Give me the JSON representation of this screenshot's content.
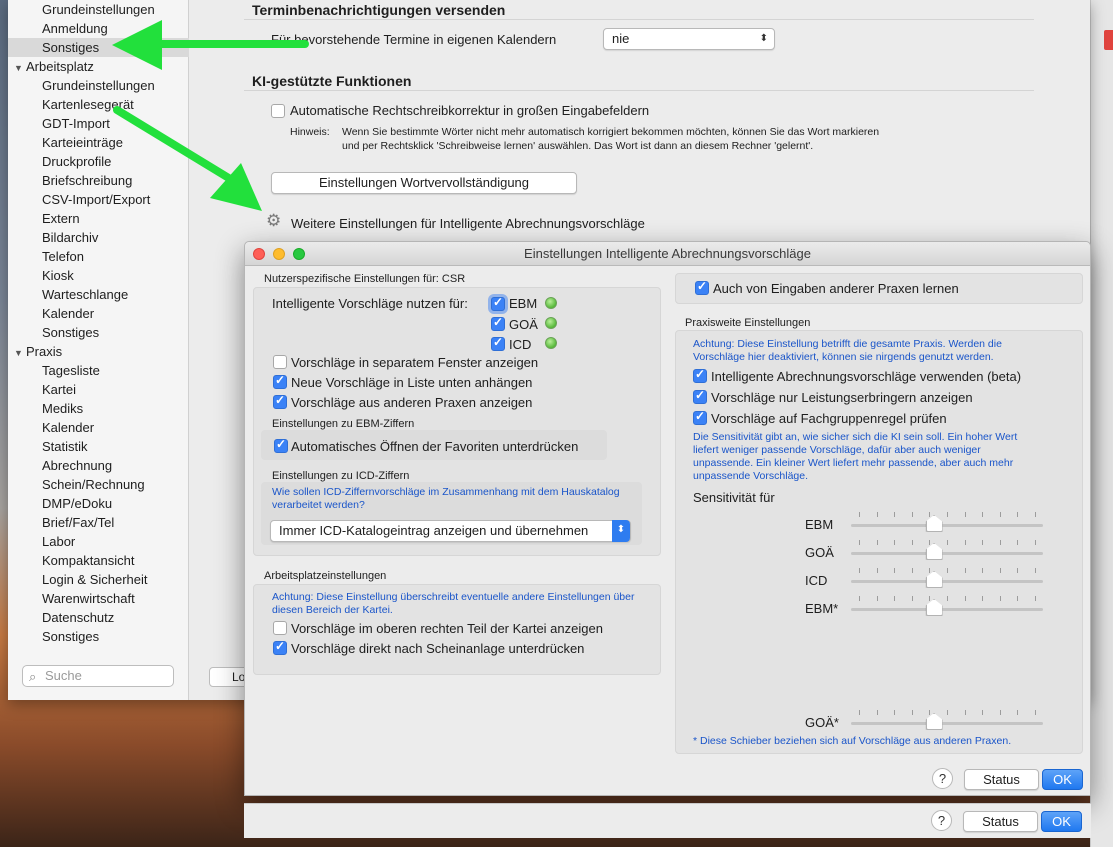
{
  "sidebar": {
    "items_top": [
      "Grundeinstellungen",
      "Anmeldung",
      "Sonstiges"
    ],
    "group_arbeitsplatz": "Arbeitsplatz",
    "arbeitsplatz_items": [
      "Grundeinstellungen",
      "Kartenlesegerät",
      "GDT-Import",
      "Karteieinträge",
      "Druckprofile",
      "Briefschreibung",
      "CSV-Import/Export",
      "Extern",
      "Bildarchiv",
      "Telefon",
      "Kiosk",
      "Warteschlange",
      "Kalender",
      "Sonstiges"
    ],
    "group_praxis": "Praxis",
    "praxis_items": [
      "Tagesliste",
      "Kartei",
      "Mediks",
      "Kalender",
      "Statistik",
      "Abrechnung",
      "Schein/Rechnung",
      "DMP/eDoku",
      "Brief/Fax/Tel",
      "Labor",
      "Kompaktansicht",
      "Login & Sicherheit",
      "Warenwirtschaft",
      "Datenschutz",
      "Sonstiges"
    ],
    "search_placeholder": "Suche",
    "lo_button": "Lo"
  },
  "content": {
    "termin_title": "Terminbenachrichtigungen versenden",
    "termin_label": "Für bevorstehende Termine in eigenen Kalendern",
    "termin_value": "nie",
    "ki_title": "KI-gestützte Funktionen",
    "autocorrect_label": "Automatische Rechtschreibkorrektur in großen Eingabefeldern",
    "hint_label": "Hinweis:",
    "hint_text_1": "Wenn Sie bestimmte Wörter nicht mehr automatisch korrigiert bekommen möchten, können Sie das Wort markieren",
    "hint_text_2": "und per Rechtsklick 'Schreibweise lernen' auswählen. Das Wort ist dann an diesem Rechner 'gelernt'.",
    "wordcompletion_button": "Einstellungen Wortvervollständigung",
    "weitere_label": "Weitere Einstellungen für Intelligente Abrechnungsvorschläge"
  },
  "dialog": {
    "title": "Einstellungen Intelligente Abrechnungsvorschläge",
    "user_group_label": "Nutzerspezifische Einstellungen für: CSR",
    "use_for_label": "Intelligente Vorschläge nutzen für:",
    "use_for_options": [
      {
        "label": "EBM",
        "checked": true
      },
      {
        "label": "GOÄ",
        "checked": true
      },
      {
        "label": "ICD",
        "checked": true
      }
    ],
    "user_options": [
      {
        "label": "Vorschläge in separatem Fenster anzeigen",
        "checked": false
      },
      {
        "label": "Neue Vorschläge in Liste unten anhängen",
        "checked": true
      },
      {
        "label": "Vorschläge aus anderen Praxen anzeigen",
        "checked": true
      }
    ],
    "ebm_label": "Einstellungen zu EBM-Ziffern",
    "ebm_option": {
      "label": "Automatisches Öffnen der Favoriten unterdrücken",
      "checked": true
    },
    "icd_label": "Einstellungen zu ICD-Ziffern",
    "icd_note": "Wie sollen ICD-Ziffernvorschläge im Zusammenhang mit dem Hauskatalog verarbeitet werden?",
    "icd_select": "Immer ICD-Katalogeintrag anzeigen und übernehmen",
    "workplace_label": "Arbeitsplatzeinstellungen",
    "workplace_note": "Achtung: Diese Einstellung überschreibt eventuelle andere Einstellungen über diesen Bereich der Kartei.",
    "workplace_options": [
      {
        "label": "Vorschläge im oberen rechten Teil der Kartei anzeigen",
        "checked": false
      },
      {
        "label": "Vorschläge direkt nach Scheinanlage unterdrücken",
        "checked": true
      }
    ],
    "learn_option": {
      "label": "Auch von Eingaben anderer Praxen lernen",
      "checked": true
    },
    "practice_label": "Praxisweite Einstellungen",
    "practice_note": "Achtung: Diese Einstellung betrifft die gesamte Praxis. Werden die Vorschläge hier deaktiviert, können sie nirgends genutzt werden.",
    "practice_options": [
      {
        "label": "Intelligente Abrechnungsvorschläge verwenden (beta)",
        "checked": true
      },
      {
        "label": "Vorschläge nur Leistungserbringern anzeigen",
        "checked": true
      },
      {
        "label": "Vorschläge auf Fachgruppenregel prüfen",
        "checked": true
      }
    ],
    "sensitivity_note": "Die Sensitivität gibt an, wie sicher sich die KI sein soll. Ein hoher Wert liefert weniger passende Vorschläge, dafür aber auch weniger unpassende. Ein kleiner Wert liefert mehr passende, aber auch mehr unpassende Vorschläge.",
    "sensitivity_label": "Sensitivität für",
    "sliders": [
      {
        "label": "EBM",
        "value": 0.43
      },
      {
        "label": "GOÄ",
        "value": 0.43
      },
      {
        "label": "ICD",
        "value": 0.43
      },
      {
        "label": "EBM*",
        "value": 0.43
      },
      {
        "label": "GOÄ*",
        "value": 0.43
      }
    ],
    "footnote": "* Diese Schieber beziehen sich auf Vorschläge aus anderen Praxen.",
    "help": "?",
    "status_button": "Status",
    "ok_button": "OK"
  },
  "bottom_bar": {
    "help": "?",
    "status_button": "Status",
    "ok_button": "OK"
  },
  "colors": {
    "accent": "#3b82f6",
    "annotation_arrow": "#22e03c",
    "note_blue": "#1a55c9"
  }
}
